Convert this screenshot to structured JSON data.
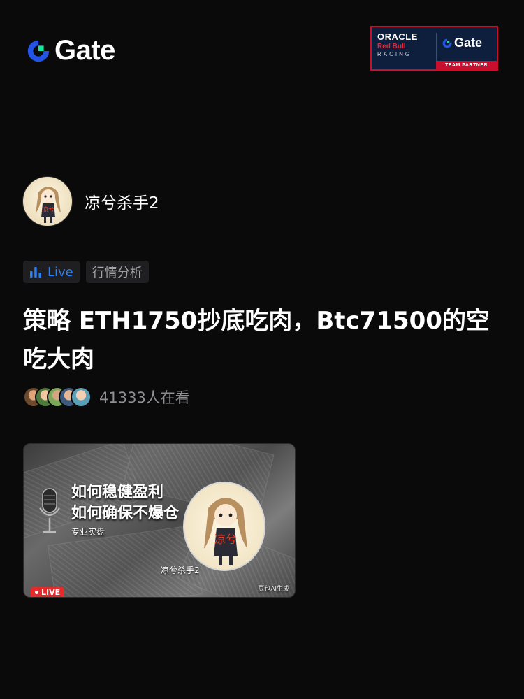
{
  "header": {
    "logo_text": "Gate",
    "logo_icon": "gate-logo-icon",
    "partner": {
      "oracle": "ORACLE",
      "redbull": "Red Bull",
      "racing": "RACING",
      "gate": "Gate",
      "strip": "TEAM PARTNER"
    },
    "brand_color": "#2354e6",
    "accent_green": "#17e6a1"
  },
  "host": {
    "name": "凉兮杀手2",
    "avatar_badge": "凉兮"
  },
  "tags": [
    {
      "label": "Live",
      "icon": "bar-chart-icon",
      "color": "#2a7ff3"
    },
    {
      "label": "行情分析"
    }
  ],
  "title": "策略 ETH1750抄底吃肉，Btc71500的空吃大肉",
  "viewers": {
    "count_text": "41333人在看",
    "avatars": 5
  },
  "thumbnail": {
    "headline_1": "如何稳健盈利",
    "headline_2": "如何确保不爆仓",
    "sub": "专业实盘",
    "host": "凉兮杀手2",
    "badge": "凉兮",
    "ai_note": "豆包AI生成",
    "live_label": "LIVE"
  }
}
